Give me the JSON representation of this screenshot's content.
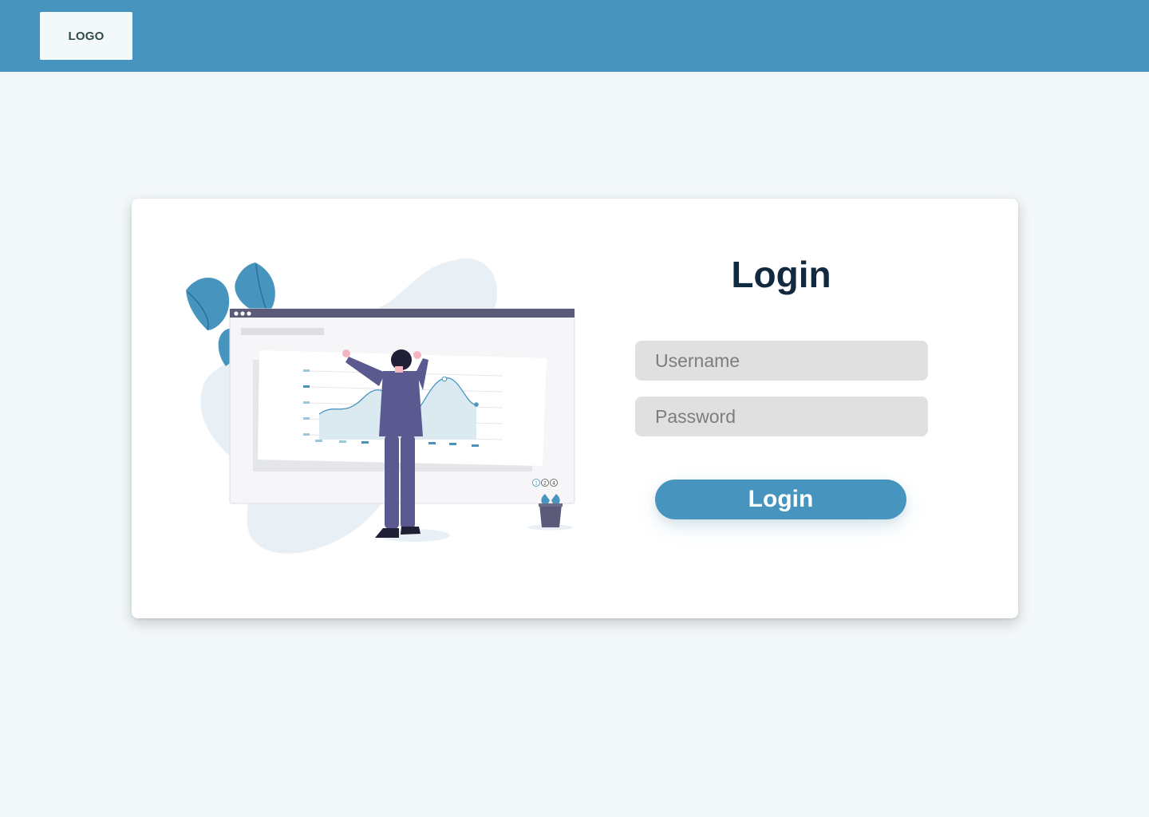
{
  "header": {
    "logo_text": "LOGO",
    "background": "#4795be"
  },
  "login": {
    "title": "Login",
    "username": {
      "value": "",
      "placeholder": "Username"
    },
    "password": {
      "value": "",
      "placeholder": "Password"
    },
    "submit_label": "Login"
  },
  "illustration": {
    "semantic": "person-analyzing-chart-illustration",
    "pagination_labels": [
      "1",
      "2",
      "4"
    ]
  },
  "colors": {
    "page_background": "#f2f7fa",
    "accent": "#4795be",
    "title": "#122a40",
    "field_background": "#e0e0e0"
  }
}
